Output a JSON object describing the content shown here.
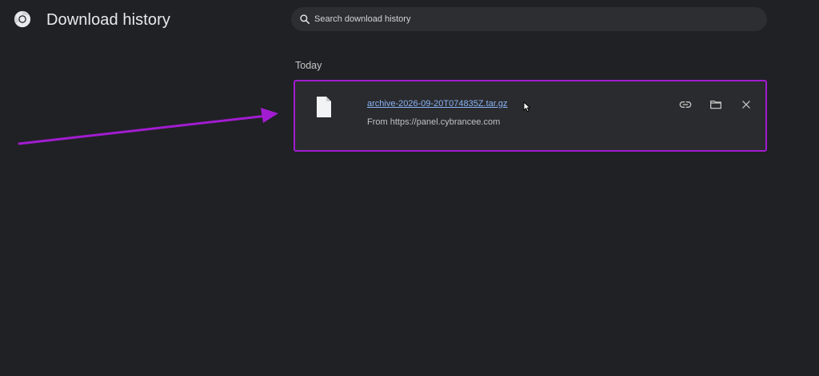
{
  "header": {
    "title": "Download history",
    "logo_icon": "chrome-logo-icon"
  },
  "search": {
    "placeholder": "Search download history",
    "icon": "search-icon"
  },
  "sections": [
    {
      "label": "Today",
      "items": [
        {
          "file_name": "archive-2026-09-20T074835Z.tar.gz",
          "source": "From https://panel.cybrancee.com",
          "file_icon": "file-icon",
          "actions": [
            {
              "name": "copy-link",
              "icon": "link-icon"
            },
            {
              "name": "show-in-folder",
              "icon": "folder-icon"
            },
            {
              "name": "remove",
              "icon": "close-icon"
            }
          ]
        }
      ]
    }
  ],
  "colors": {
    "background": "#202124",
    "link": "#8ab4f8",
    "highlight_annotation": "#a21cd1"
  }
}
